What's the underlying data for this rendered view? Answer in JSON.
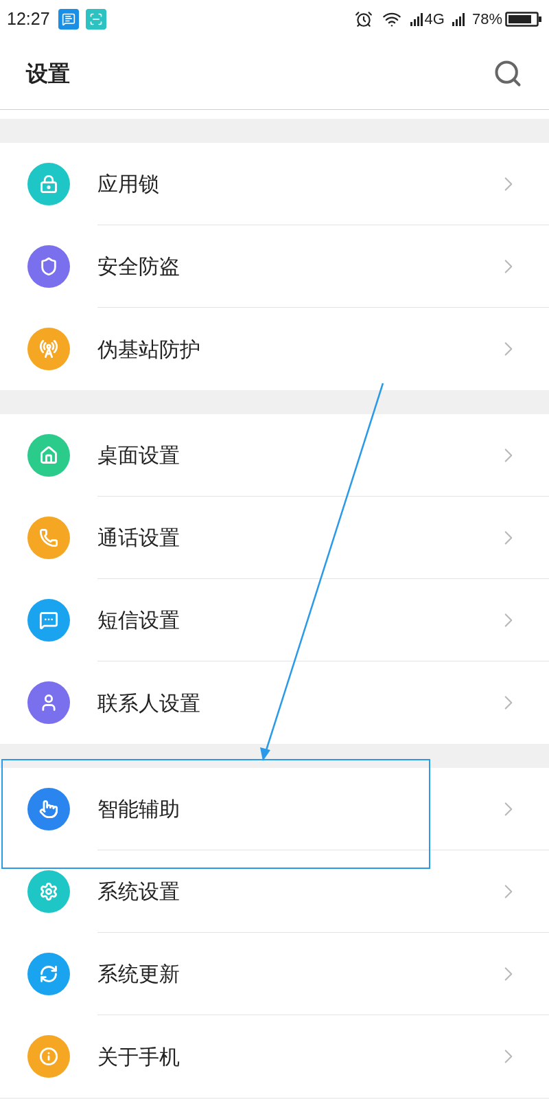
{
  "status_bar": {
    "time": "12:27",
    "network": "4G",
    "battery": "78%"
  },
  "header": {
    "title": "设置"
  },
  "groups": [
    {
      "items": [
        {
          "label": "应用锁",
          "color": "#1fc6c6"
        },
        {
          "label": "安全防盗",
          "color": "#7a70ee"
        },
        {
          "label": "伪基站防护",
          "color": "#f5a623"
        }
      ]
    },
    {
      "items": [
        {
          "label": "桌面设置",
          "color": "#2bcb8c"
        },
        {
          "label": "通话设置",
          "color": "#f5a623"
        },
        {
          "label": "短信设置",
          "color": "#1aa3ef"
        },
        {
          "label": "联系人设置",
          "color": "#7a70ee"
        }
      ]
    },
    {
      "items": [
        {
          "label": "智能辅助",
          "color": "#2a86ee"
        },
        {
          "label": "系统设置",
          "color": "#1fc6c6"
        },
        {
          "label": "系统更新",
          "color": "#1aa3ef"
        },
        {
          "label": "关于手机",
          "color": "#f5a623"
        }
      ]
    }
  ]
}
